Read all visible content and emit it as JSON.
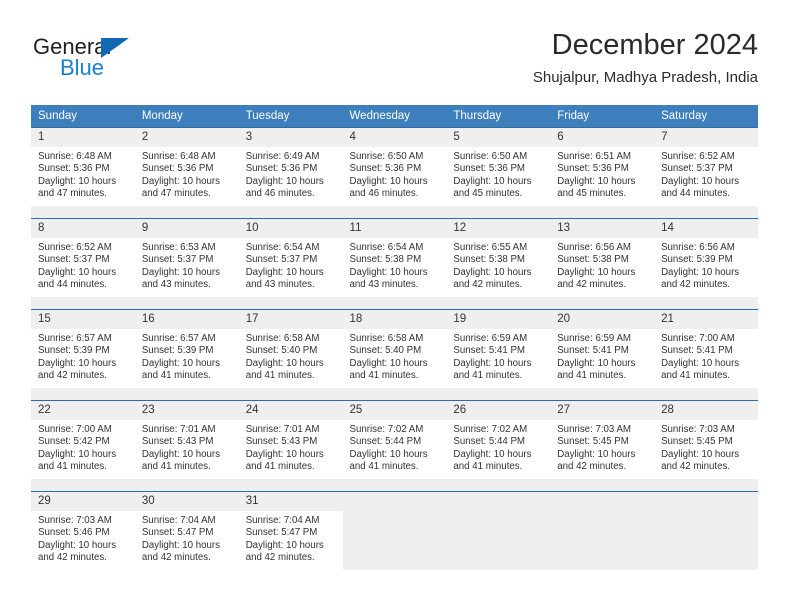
{
  "logo": {
    "word_dark": "General",
    "word_blue": "Blue",
    "triangle_color": "#1268b3",
    "blue_color": "#1a7fd4"
  },
  "header": {
    "title": "December 2024",
    "subtitle": "Shujalpur, Madhya Pradesh, India"
  },
  "theme": {
    "header_bg": "#3d7ebd",
    "row_border": "#2e6da4",
    "daynum_bg": "#efefef",
    "cell_bg": "#ffffff"
  },
  "weekdays": [
    "Sunday",
    "Monday",
    "Tuesday",
    "Wednesday",
    "Thursday",
    "Friday",
    "Saturday"
  ],
  "weeks": [
    [
      {
        "day": "1",
        "sunrise": "Sunrise: 6:48 AM",
        "sunset": "Sunset: 5:36 PM",
        "daylight1": "Daylight: 10 hours",
        "daylight2": "and 47 minutes."
      },
      {
        "day": "2",
        "sunrise": "Sunrise: 6:48 AM",
        "sunset": "Sunset: 5:36 PM",
        "daylight1": "Daylight: 10 hours",
        "daylight2": "and 47 minutes."
      },
      {
        "day": "3",
        "sunrise": "Sunrise: 6:49 AM",
        "sunset": "Sunset: 5:36 PM",
        "daylight1": "Daylight: 10 hours",
        "daylight2": "and 46 minutes."
      },
      {
        "day": "4",
        "sunrise": "Sunrise: 6:50 AM",
        "sunset": "Sunset: 5:36 PM",
        "daylight1": "Daylight: 10 hours",
        "daylight2": "and 46 minutes."
      },
      {
        "day": "5",
        "sunrise": "Sunrise: 6:50 AM",
        "sunset": "Sunset: 5:36 PM",
        "daylight1": "Daylight: 10 hours",
        "daylight2": "and 45 minutes."
      },
      {
        "day": "6",
        "sunrise": "Sunrise: 6:51 AM",
        "sunset": "Sunset: 5:36 PM",
        "daylight1": "Daylight: 10 hours",
        "daylight2": "and 45 minutes."
      },
      {
        "day": "7",
        "sunrise": "Sunrise: 6:52 AM",
        "sunset": "Sunset: 5:37 PM",
        "daylight1": "Daylight: 10 hours",
        "daylight2": "and 44 minutes."
      }
    ],
    [
      {
        "day": "8",
        "sunrise": "Sunrise: 6:52 AM",
        "sunset": "Sunset: 5:37 PM",
        "daylight1": "Daylight: 10 hours",
        "daylight2": "and 44 minutes."
      },
      {
        "day": "9",
        "sunrise": "Sunrise: 6:53 AM",
        "sunset": "Sunset: 5:37 PM",
        "daylight1": "Daylight: 10 hours",
        "daylight2": "and 43 minutes."
      },
      {
        "day": "10",
        "sunrise": "Sunrise: 6:54 AM",
        "sunset": "Sunset: 5:37 PM",
        "daylight1": "Daylight: 10 hours",
        "daylight2": "and 43 minutes."
      },
      {
        "day": "11",
        "sunrise": "Sunrise: 6:54 AM",
        "sunset": "Sunset: 5:38 PM",
        "daylight1": "Daylight: 10 hours",
        "daylight2": "and 43 minutes."
      },
      {
        "day": "12",
        "sunrise": "Sunrise: 6:55 AM",
        "sunset": "Sunset: 5:38 PM",
        "daylight1": "Daylight: 10 hours",
        "daylight2": "and 42 minutes."
      },
      {
        "day": "13",
        "sunrise": "Sunrise: 6:56 AM",
        "sunset": "Sunset: 5:38 PM",
        "daylight1": "Daylight: 10 hours",
        "daylight2": "and 42 minutes."
      },
      {
        "day": "14",
        "sunrise": "Sunrise: 6:56 AM",
        "sunset": "Sunset: 5:39 PM",
        "daylight1": "Daylight: 10 hours",
        "daylight2": "and 42 minutes."
      }
    ],
    [
      {
        "day": "15",
        "sunrise": "Sunrise: 6:57 AM",
        "sunset": "Sunset: 5:39 PM",
        "daylight1": "Daylight: 10 hours",
        "daylight2": "and 42 minutes."
      },
      {
        "day": "16",
        "sunrise": "Sunrise: 6:57 AM",
        "sunset": "Sunset: 5:39 PM",
        "daylight1": "Daylight: 10 hours",
        "daylight2": "and 41 minutes."
      },
      {
        "day": "17",
        "sunrise": "Sunrise: 6:58 AM",
        "sunset": "Sunset: 5:40 PM",
        "daylight1": "Daylight: 10 hours",
        "daylight2": "and 41 minutes."
      },
      {
        "day": "18",
        "sunrise": "Sunrise: 6:58 AM",
        "sunset": "Sunset: 5:40 PM",
        "daylight1": "Daylight: 10 hours",
        "daylight2": "and 41 minutes."
      },
      {
        "day": "19",
        "sunrise": "Sunrise: 6:59 AM",
        "sunset": "Sunset: 5:41 PM",
        "daylight1": "Daylight: 10 hours",
        "daylight2": "and 41 minutes."
      },
      {
        "day": "20",
        "sunrise": "Sunrise: 6:59 AM",
        "sunset": "Sunset: 5:41 PM",
        "daylight1": "Daylight: 10 hours",
        "daylight2": "and 41 minutes."
      },
      {
        "day": "21",
        "sunrise": "Sunrise: 7:00 AM",
        "sunset": "Sunset: 5:41 PM",
        "daylight1": "Daylight: 10 hours",
        "daylight2": "and 41 minutes."
      }
    ],
    [
      {
        "day": "22",
        "sunrise": "Sunrise: 7:00 AM",
        "sunset": "Sunset: 5:42 PM",
        "daylight1": "Daylight: 10 hours",
        "daylight2": "and 41 minutes."
      },
      {
        "day": "23",
        "sunrise": "Sunrise: 7:01 AM",
        "sunset": "Sunset: 5:43 PM",
        "daylight1": "Daylight: 10 hours",
        "daylight2": "and 41 minutes."
      },
      {
        "day": "24",
        "sunrise": "Sunrise: 7:01 AM",
        "sunset": "Sunset: 5:43 PM",
        "daylight1": "Daylight: 10 hours",
        "daylight2": "and 41 minutes."
      },
      {
        "day": "25",
        "sunrise": "Sunrise: 7:02 AM",
        "sunset": "Sunset: 5:44 PM",
        "daylight1": "Daylight: 10 hours",
        "daylight2": "and 41 minutes."
      },
      {
        "day": "26",
        "sunrise": "Sunrise: 7:02 AM",
        "sunset": "Sunset: 5:44 PM",
        "daylight1": "Daylight: 10 hours",
        "daylight2": "and 41 minutes."
      },
      {
        "day": "27",
        "sunrise": "Sunrise: 7:03 AM",
        "sunset": "Sunset: 5:45 PM",
        "daylight1": "Daylight: 10 hours",
        "daylight2": "and 42 minutes."
      },
      {
        "day": "28",
        "sunrise": "Sunrise: 7:03 AM",
        "sunset": "Sunset: 5:45 PM",
        "daylight1": "Daylight: 10 hours",
        "daylight2": "and 42 minutes."
      }
    ],
    [
      {
        "day": "29",
        "sunrise": "Sunrise: 7:03 AM",
        "sunset": "Sunset: 5:46 PM",
        "daylight1": "Daylight: 10 hours",
        "daylight2": "and 42 minutes."
      },
      {
        "day": "30",
        "sunrise": "Sunrise: 7:04 AM",
        "sunset": "Sunset: 5:47 PM",
        "daylight1": "Daylight: 10 hours",
        "daylight2": "and 42 minutes."
      },
      {
        "day": "31",
        "sunrise": "Sunrise: 7:04 AM",
        "sunset": "Sunset: 5:47 PM",
        "daylight1": "Daylight: 10 hours",
        "daylight2": "and 42 minutes."
      },
      {
        "day": "",
        "sunrise": "",
        "sunset": "",
        "daylight1": "",
        "daylight2": ""
      },
      {
        "day": "",
        "sunrise": "",
        "sunset": "",
        "daylight1": "",
        "daylight2": ""
      },
      {
        "day": "",
        "sunrise": "",
        "sunset": "",
        "daylight1": "",
        "daylight2": ""
      },
      {
        "day": "",
        "sunrise": "",
        "sunset": "",
        "daylight1": "",
        "daylight2": ""
      }
    ]
  ]
}
